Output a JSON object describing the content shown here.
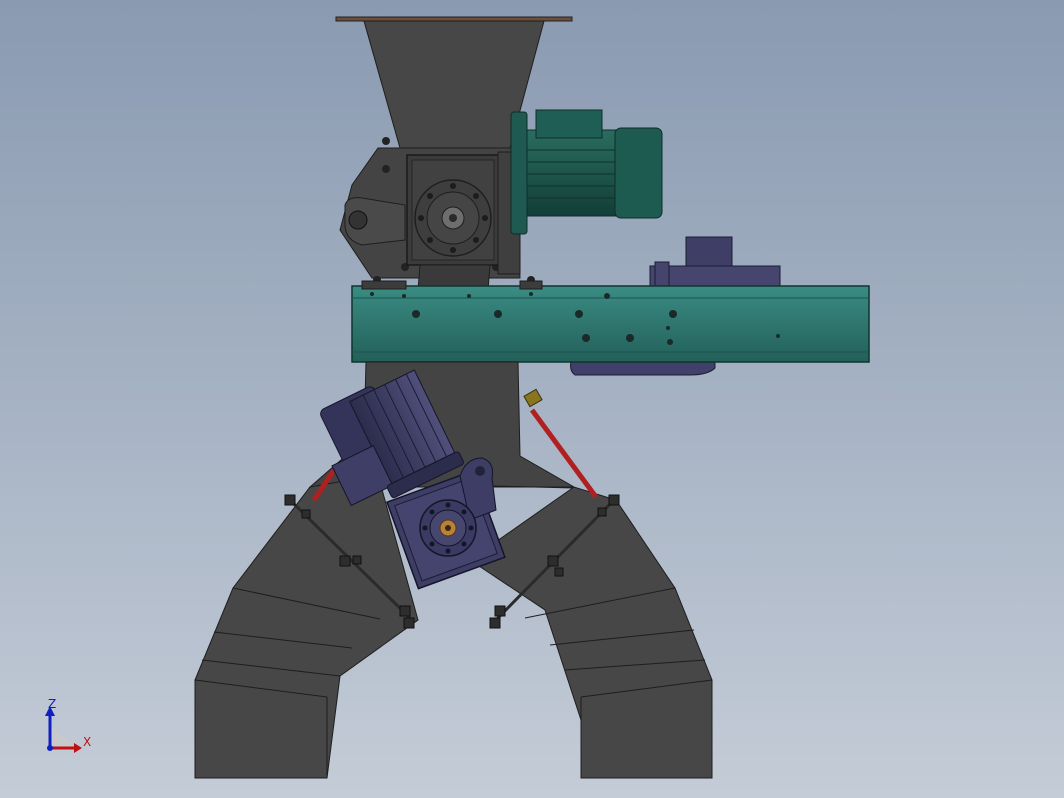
{
  "triad": {
    "z_label": "Z",
    "x_label": "X",
    "colors": {
      "z": "#1020c0",
      "x": "#c01010"
    }
  },
  "colors": {
    "background_top": "#8a9ab1",
    "background_bottom": "#c4ccd7",
    "housing": "#454545",
    "conveyor": "#2e7a72",
    "gearbox_blue": "#3d3d66",
    "motor_teal": "#1d5a50",
    "actuator_red": "#b02020"
  }
}
